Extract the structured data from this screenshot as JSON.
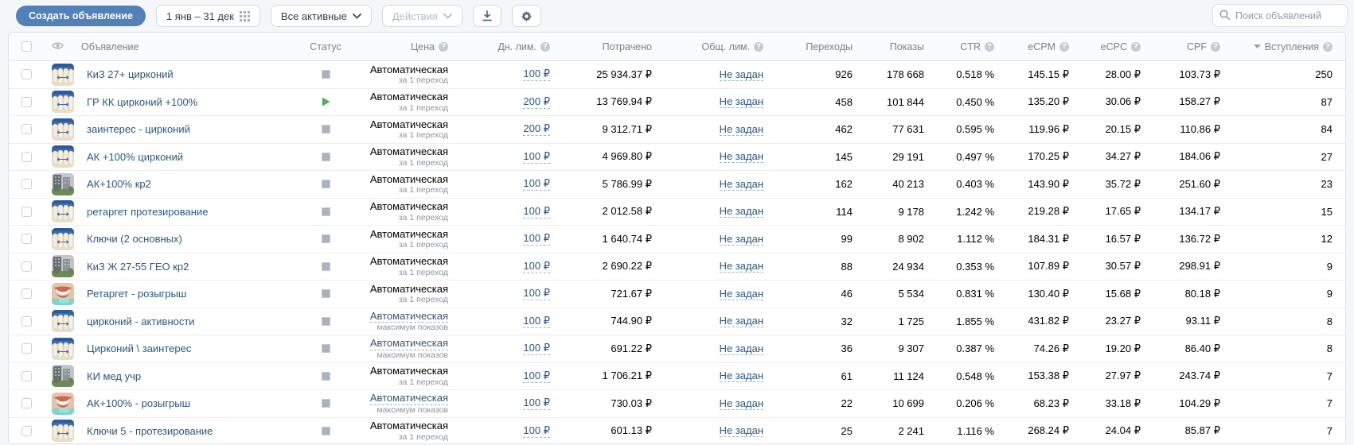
{
  "toolbar": {
    "create_button": "Создать объявление",
    "date_range": "1 янв – 31 дек",
    "filter_selected": "Все активные",
    "actions_label": "Действия",
    "search_placeholder": "Поиск объявлений"
  },
  "table": {
    "headers": {
      "ad": "Объявление",
      "status": "Статус",
      "price": "Цена",
      "day_limit": "Дн. лим.",
      "spent": "Потрачено",
      "total_limit": "Общ. лим.",
      "clicks": "Переходы",
      "impressions": "Показы",
      "ctr": "CTR",
      "ecpm": "eCPM",
      "ecpc": "eCPC",
      "cpf": "CPF",
      "joins": "Вступления"
    },
    "sorted_by": "joins",
    "rows": [
      {
        "name": "КиЗ 27+ цирконий",
        "status": "paused",
        "thumb": "teeth-photo",
        "price_type": "Автоматическая",
        "price_sub": "за 1 переход",
        "day_limit": "100 ₽",
        "spent": "25 934.37 ₽",
        "total_limit": "Не задан",
        "clicks": "926",
        "impressions": "178 668",
        "ctr": "0.518 %",
        "ecpm": "145.15 ₽",
        "ecpc": "28.00 ₽",
        "cpf": "103.73 ₽",
        "joins": "250"
      },
      {
        "name": "ГР КК цирконий +100%",
        "status": "active",
        "thumb": "teeth-photo",
        "price_type": "Автоматическая",
        "price_sub": "за 1 переход",
        "day_limit": "200 ₽",
        "spent": "13 769.94 ₽",
        "total_limit": "Не задан",
        "clicks": "458",
        "impressions": "101 844",
        "ctr": "0.450 %",
        "ecpm": "135.20 ₽",
        "ecpc": "30.06 ₽",
        "cpf": "158.27 ₽",
        "joins": "87"
      },
      {
        "name": "заинтерес - цирконий",
        "status": "paused",
        "thumb": "teeth-photo",
        "price_type": "Автоматическая",
        "price_sub": "за 1 переход",
        "day_limit": "200 ₽",
        "spent": "9 312.71 ₽",
        "total_limit": "Не задан",
        "clicks": "462",
        "impressions": "77 631",
        "ctr": "0.595 %",
        "ecpm": "119.96 ₽",
        "ecpc": "20.15 ₽",
        "cpf": "110.86 ₽",
        "joins": "84"
      },
      {
        "name": "АК +100% цирконий",
        "status": "paused",
        "thumb": "teeth-photo",
        "price_type": "Автоматическая",
        "price_sub": "за 1 переход",
        "day_limit": "100 ₽",
        "spent": "4 969.80 ₽",
        "total_limit": "Не задан",
        "clicks": "145",
        "impressions": "29 191",
        "ctr": "0.497 %",
        "ecpm": "170.25 ₽",
        "ecpc": "34.27 ₽",
        "cpf": "184.06 ₽",
        "joins": "27"
      },
      {
        "name": "АК+100% кр2",
        "status": "paused",
        "thumb": "building-photo",
        "price_type": "Автоматическая",
        "price_sub": "за 1 переход",
        "day_limit": "100 ₽",
        "spent": "5 786.99 ₽",
        "total_limit": "Не задан",
        "clicks": "162",
        "impressions": "40 213",
        "ctr": "0.403 %",
        "ecpm": "143.90 ₽",
        "ecpc": "35.72 ₽",
        "cpf": "251.60 ₽",
        "joins": "23"
      },
      {
        "name": "ретаргет протезирование",
        "status": "paused",
        "thumb": "teeth-photo",
        "price_type": "Автоматическая",
        "price_sub": "за 1 переход",
        "day_limit": "100 ₽",
        "spent": "2 012.58 ₽",
        "total_limit": "Не задан",
        "clicks": "114",
        "impressions": "9 178",
        "ctr": "1.242 %",
        "ecpm": "219.28 ₽",
        "ecpc": "17.65 ₽",
        "cpf": "134.17 ₽",
        "joins": "15"
      },
      {
        "name": "Ключи (2 основных)",
        "status": "paused",
        "thumb": "teeth-photo",
        "price_type": "Автоматическая",
        "price_sub": "за 1 переход",
        "day_limit": "100 ₽",
        "spent": "1 640.74 ₽",
        "total_limit": "Не задан",
        "clicks": "99",
        "impressions": "8 902",
        "ctr": "1.112 %",
        "ecpm": "184.31 ₽",
        "ecpc": "16.57 ₽",
        "cpf": "136.72 ₽",
        "joins": "12"
      },
      {
        "name": "КиЗ Ж 27-55 ГЕО кр2",
        "status": "paused",
        "thumb": "building-photo",
        "price_type": "Автоматическая",
        "price_sub": "за 1 переход",
        "day_limit": "100 ₽",
        "spent": "2 690.22 ₽",
        "total_limit": "Не задан",
        "clicks": "88",
        "impressions": "24 934",
        "ctr": "0.353 %",
        "ecpm": "107.89 ₽",
        "ecpc": "30.57 ₽",
        "cpf": "298.91 ₽",
        "joins": "9"
      },
      {
        "name": "Ретаргет - розыгрыш",
        "status": "paused",
        "thumb": "smile-photo",
        "price_type": "Автоматическая",
        "price_sub": "за 1 переход",
        "day_limit": "100 ₽",
        "spent": "721.67 ₽",
        "total_limit": "Не задан",
        "clicks": "46",
        "impressions": "5 534",
        "ctr": "0.831 %",
        "ecpm": "130.40 ₽",
        "ecpc": "15.68 ₽",
        "cpf": "80.18 ₽",
        "joins": "9"
      },
      {
        "name": "цирконий - активности",
        "status": "paused",
        "thumb": "teeth-photo",
        "price_type": "Автоматическая",
        "price_sub": "максимум показов",
        "day_limit": "100 ₽",
        "spent": "744.90 ₽",
        "total_limit": "Не задан",
        "clicks": "32",
        "impressions": "1 725",
        "ctr": "1.855 %",
        "ecpm": "431.82 ₽",
        "ecpc": "23.27 ₽",
        "cpf": "93.11 ₽",
        "joins": "8"
      },
      {
        "name": "Цирконий \\ заинтерес",
        "status": "paused",
        "thumb": "teeth-photo",
        "price_type": "Автоматическая",
        "price_sub": "максимум показов",
        "day_limit": "100 ₽",
        "spent": "691.22 ₽",
        "total_limit": "Не задан",
        "clicks": "36",
        "impressions": "9 307",
        "ctr": "0.387 %",
        "ecpm": "74.26 ₽",
        "ecpc": "19.20 ₽",
        "cpf": "86.40 ₽",
        "joins": "8"
      },
      {
        "name": "КИ мед учр",
        "status": "paused",
        "thumb": "building-photo",
        "price_type": "Автоматическая",
        "price_sub": "за 1 переход",
        "day_limit": "100 ₽",
        "spent": "1 706.21 ₽",
        "total_limit": "Не задан",
        "clicks": "61",
        "impressions": "11 124",
        "ctr": "0.548 %",
        "ecpm": "153.38 ₽",
        "ecpc": "27.97 ₽",
        "cpf": "243.74 ₽",
        "joins": "7"
      },
      {
        "name": "АК+100% - розыгрыш",
        "status": "paused",
        "thumb": "smile-photo",
        "price_type": "Автоматическая",
        "price_sub": "максимум показов",
        "day_limit": "100 ₽",
        "spent": "730.03 ₽",
        "total_limit": "Не задан",
        "clicks": "22",
        "impressions": "10 699",
        "ctr": "0.206 %",
        "ecpm": "68.23 ₽",
        "ecpc": "33.18 ₽",
        "cpf": "104.29 ₽",
        "joins": "7"
      },
      {
        "name": "Ключи 5 - протезирование",
        "status": "paused",
        "thumb": "teeth-photo",
        "price_type": "Автоматическая",
        "price_sub": "за 1 переход",
        "day_limit": "100 ₽",
        "spent": "601.13 ₽",
        "total_limit": "Не задан",
        "clicks": "25",
        "impressions": "2 241",
        "ctr": "1.116 %",
        "ecpm": "268.24 ₽",
        "ecpc": "24.04 ₽",
        "cpf": "85.87 ₽",
        "joins": "7"
      }
    ]
  },
  "colors": {
    "accent": "#5181b8",
    "link": "#2a5885",
    "status_active": "#4bb34b",
    "status_paused": "#a9b2bd",
    "header_text": "#79828d"
  }
}
